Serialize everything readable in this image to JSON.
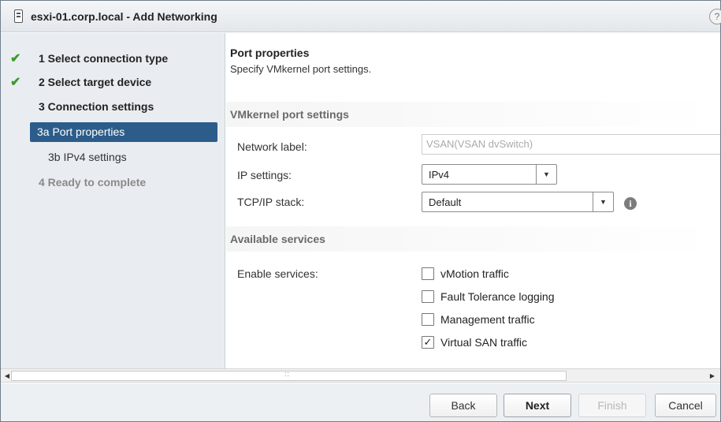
{
  "window": {
    "title": "esxi-01.corp.local - Add Networking",
    "help_symbol": "?"
  },
  "nav": {
    "steps": [
      {
        "label": "1  Select connection type",
        "completed": true
      },
      {
        "label": "2  Select target device",
        "completed": true
      },
      {
        "label": "3  Connection settings",
        "completed": false
      },
      {
        "label": "3a  Port properties",
        "active": true
      },
      {
        "label": "3b  IPv4 settings"
      },
      {
        "label": "4  Ready to complete",
        "disabled": true
      }
    ],
    "check_glyph": "✔"
  },
  "content": {
    "title": "Port properties",
    "subtitle": "Specify VMkernel port settings.",
    "vmk_section": "VMkernel port settings",
    "network_label": {
      "label": "Network label:",
      "value": "VSAN(VSAN dvSwitch)"
    },
    "ip_settings": {
      "label": "IP settings:",
      "value": "IPv4"
    },
    "tcpip_stack": {
      "label": "TCP/IP stack:",
      "value": "Default"
    },
    "info_symbol": "i",
    "services_section": "Available services",
    "enable_services_label": "Enable services:",
    "services": [
      {
        "label": "vMotion traffic",
        "checked": false
      },
      {
        "label": "Fault Tolerance logging",
        "checked": false
      },
      {
        "label": "Management traffic",
        "checked": false
      },
      {
        "label": "Virtual SAN traffic",
        "checked": true
      }
    ]
  },
  "scrollbar": {
    "left_arrow": "◀",
    "right_arrow": "▶",
    "grip": "::"
  },
  "footer": {
    "back": "Back",
    "next": "Next",
    "finish": "Finish",
    "cancel": "Cancel"
  },
  "dropdown_glyph": "▼",
  "colors": {
    "active_step_bg": "#2c5d8a",
    "check_green": "#3a9b2b",
    "nav_bg": "#e9edf1"
  }
}
